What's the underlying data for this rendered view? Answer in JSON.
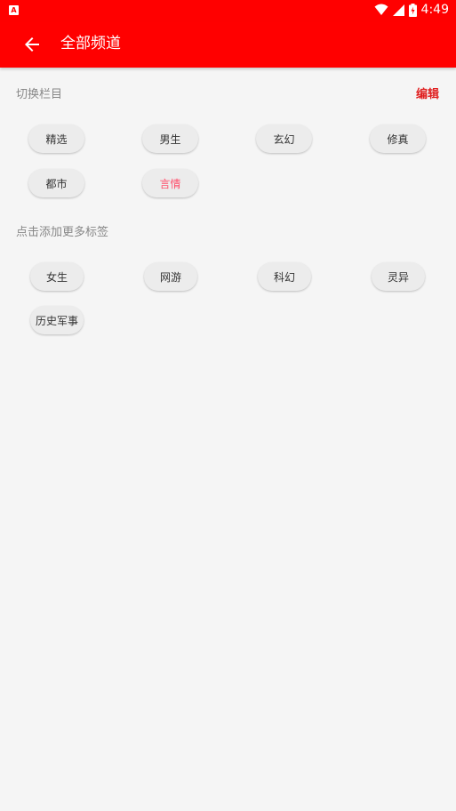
{
  "statusbar": {
    "notification_icon": "A",
    "time": "4:49"
  },
  "appbar": {
    "title": "全部频道"
  },
  "switch_section": {
    "label": "切换栏目",
    "edit_label": "编辑"
  },
  "selected_channels": [
    "精选",
    "男生",
    "玄幻",
    "修真",
    "都市",
    "言情"
  ],
  "add_section": {
    "label": "点击添加更多标签"
  },
  "more_channels": [
    "女生",
    "网游",
    "科幻",
    "灵异",
    "历史军事"
  ],
  "colors": {
    "brand": "#ff0000",
    "edit": "#e02020",
    "highlight": "#ff4d6a"
  },
  "icons": [
    "back-arrow-icon",
    "wifi-icon",
    "signal-icon",
    "battery-icon"
  ]
}
